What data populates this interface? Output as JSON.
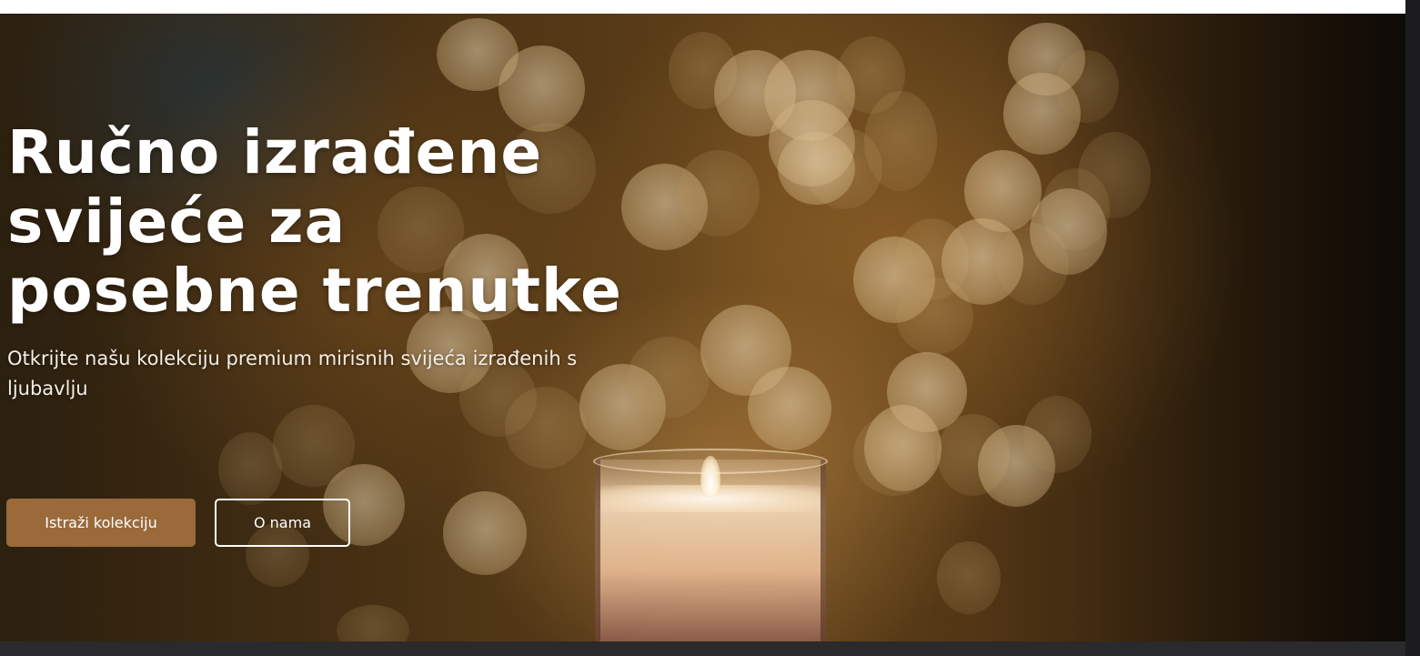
{
  "hero": {
    "title": "Ručno izrađene svijeće za posebne trenutke",
    "subtitle": "Otkrijte našu kolekciju premium mirisnih svijeća izrađenih s ljubavlju",
    "primary_button": "Istraži kolekciju",
    "secondary_button": "O nama"
  },
  "colors": {
    "primary_button_bg": "#9a6a3a",
    "text": "#ffffff"
  }
}
